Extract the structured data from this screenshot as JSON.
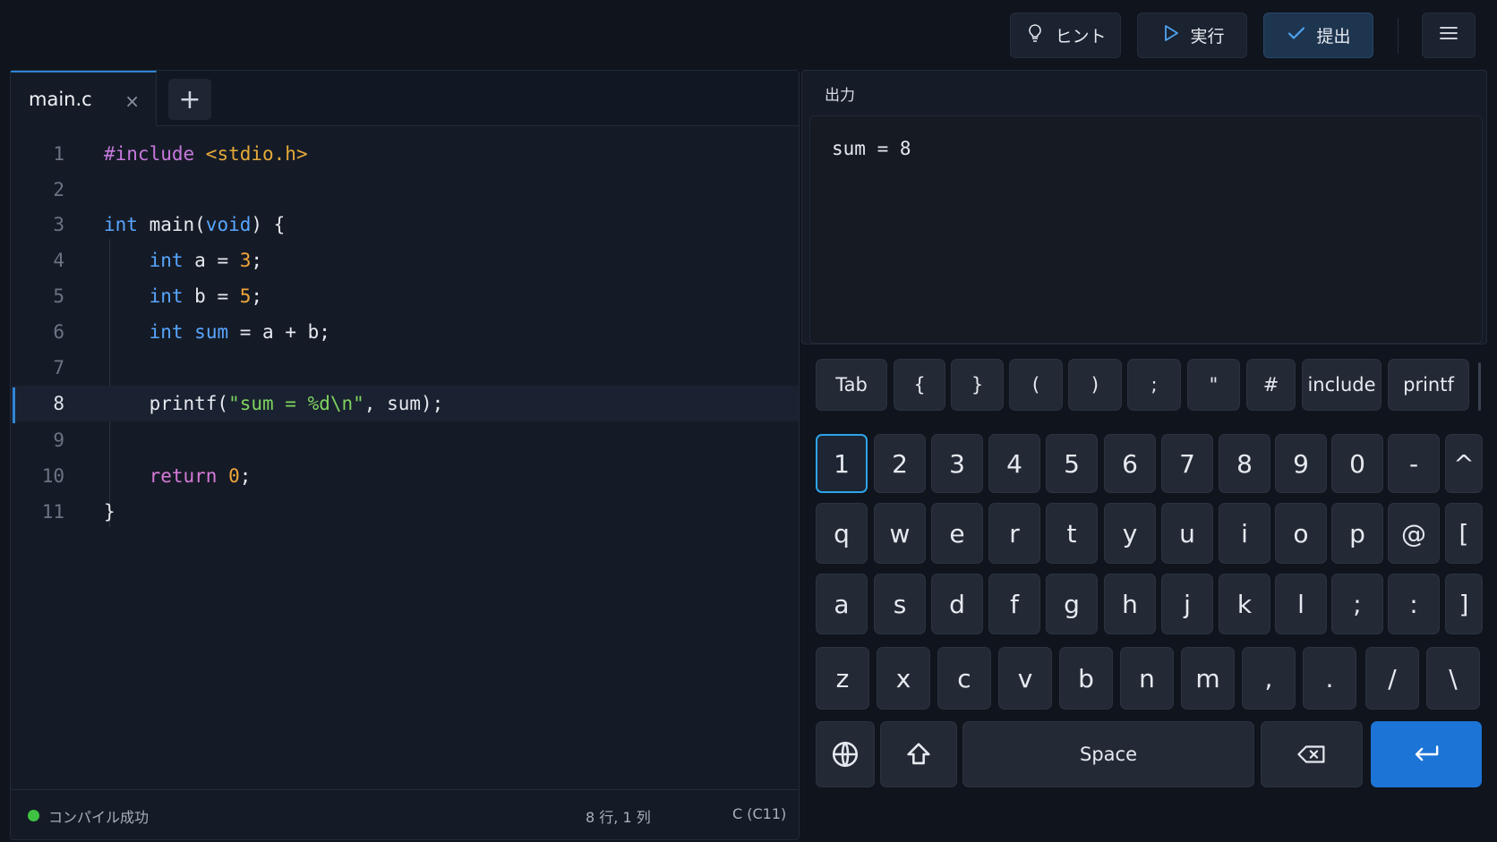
{
  "toolbar": {
    "hint_label": "ヒント",
    "run_label": "実行",
    "submit_label": "提出"
  },
  "editor": {
    "tab_name": "main.c",
    "close_glyph": "×",
    "add_glyph": "+",
    "active_line": 8,
    "lines": [
      {
        "n": "1",
        "code": "#include <stdio.h>"
      },
      {
        "n": "2",
        "code": ""
      },
      {
        "n": "3",
        "code": "int main(void) {"
      },
      {
        "n": "4",
        "code": "    int a = 3;"
      },
      {
        "n": "5",
        "code": "    int b = 5;"
      },
      {
        "n": "6",
        "code": "    int sum = a + b;"
      },
      {
        "n": "7",
        "code": ""
      },
      {
        "n": "8",
        "code": "    printf(\"sum = %d\\n\", sum);"
      },
      {
        "n": "9",
        "code": ""
      },
      {
        "n": "10",
        "code": "    return 0;"
      },
      {
        "n": "11",
        "code": "}"
      }
    ]
  },
  "status": {
    "message": "コンパイル成功",
    "position": "8 行, 1 列",
    "language": "C (C11)",
    "ok_color": "#3fc243"
  },
  "output": {
    "title": "出力",
    "text": "sum = 8"
  },
  "keyboard": {
    "symbol_row": [
      "Tab",
      "{",
      "}",
      "(",
      ")",
      ";",
      "\"",
      "#",
      "include",
      "printf"
    ],
    "number_row": [
      "1",
      "2",
      "3",
      "4",
      "5",
      "6",
      "7",
      "8",
      "9",
      "0",
      "-",
      "^"
    ],
    "row_q": [
      "q",
      "w",
      "e",
      "r",
      "t",
      "y",
      "u",
      "i",
      "o",
      "p",
      "@",
      "["
    ],
    "row_a": [
      "a",
      "s",
      "d",
      "f",
      "g",
      "h",
      "j",
      "k",
      "l",
      ";",
      ":",
      "]"
    ],
    "row_z": [
      "z",
      "x",
      "c",
      "v",
      "b",
      "n",
      "m",
      ",",
      ".",
      "/",
      "\\"
    ],
    "space_label": "Space",
    "selected_key": "1",
    "icons": [
      "globe-icon",
      "shift-icon",
      "backspace-icon",
      "enter-icon"
    ]
  },
  "colors": {
    "accent": "#2f86d6",
    "enter": "#1c74d6",
    "keyword": "#58a6ff",
    "preprocessor": "#c678dd",
    "string": "#7ed45f",
    "number": "#f0a63a"
  }
}
